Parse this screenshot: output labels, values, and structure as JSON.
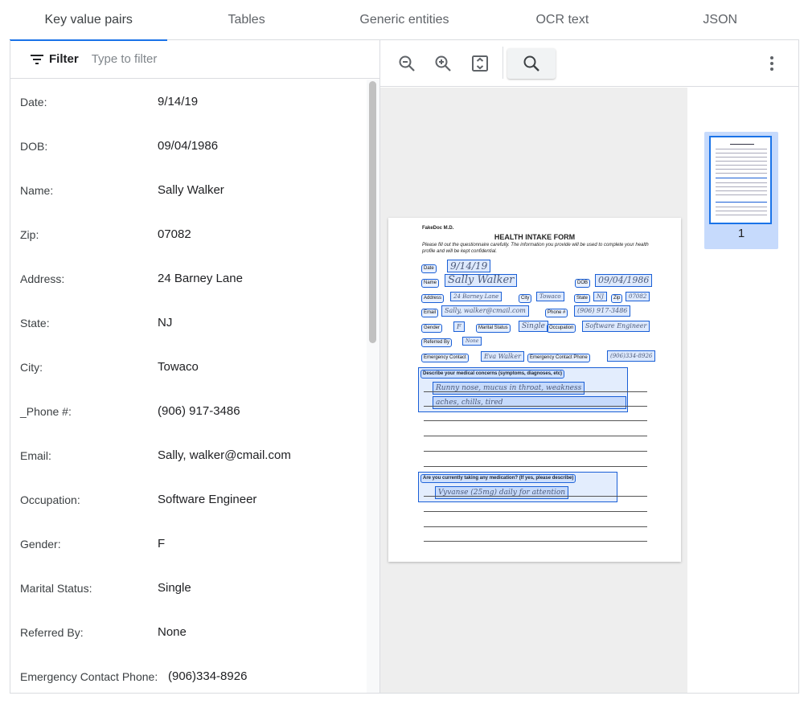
{
  "tabs": [
    "Key value pairs",
    "Tables",
    "Generic entities",
    "OCR text",
    "JSON"
  ],
  "filter": {
    "label": "Filter",
    "placeholder": "Type to filter"
  },
  "pairs": [
    {
      "key": "Date:",
      "value": "9/14/19"
    },
    {
      "key": "DOB:",
      "value": "09/04/1986"
    },
    {
      "key": "Name:",
      "value": "Sally Walker"
    },
    {
      "key": "Zip:",
      "value": "07082"
    },
    {
      "key": "Address:",
      "value": "24 Barney Lane"
    },
    {
      "key": "State:",
      "value": "NJ"
    },
    {
      "key": "City:",
      "value": "Towaco"
    },
    {
      "key": "_Phone #:",
      "value": "(906) 917-3486"
    },
    {
      "key": "Email:",
      "value": "Sally, walker@cmail.com"
    },
    {
      "key": "Occupation:",
      "value": "Software Engineer"
    },
    {
      "key": "Gender:",
      "value": "F"
    },
    {
      "key": "Marital Status:",
      "value": "Single"
    },
    {
      "key": "Referred By:",
      "value": "None"
    },
    {
      "key": "Emergency Contact Phone:",
      "value": "(906)334-8926"
    }
  ],
  "toolbar": {
    "icons": [
      "zoom-out-icon",
      "zoom-in-icon",
      "fit-page-icon",
      "search-icon",
      "more-vert-icon"
    ]
  },
  "document": {
    "org": "FakeDoc M.D.",
    "title": "HEALTH INTAKE FORM",
    "instructions": "Please fill out the questionnaire carefully. The information you provide will be used to complete your health profile and will be kept confidential.",
    "labels": {
      "date": "Date",
      "name": "Name",
      "dob": "DOB",
      "address": "Address",
      "city": "City",
      "state": "State",
      "zip": "Zip",
      "email": "Email",
      "phone": "Phone #",
      "gender": "Gender",
      "marital": "Marital Status",
      "occupation": "Occupation",
      "referred": "Referred By",
      "emergency_contact": "Emergency Contact",
      "emergency_phone": "Emergency Contact Phone",
      "concerns": "Describe your medical concerns (symptoms, diagnoses, etc)",
      "medication": "Are you currently taking any medication? (If yes, please describe)"
    },
    "handwriting": {
      "date": "9/14/19",
      "name": "Sally Walker",
      "dob": "09/04/1986",
      "address": "24 Barney Lane",
      "city": "Towaco",
      "state": "NJ",
      "zip": "07082",
      "email": "Sally, walker@cmail.com",
      "phone": "(906) 917-3486",
      "gender": "F",
      "marital": "Single",
      "occupation": "Software Engineer",
      "referred": "None",
      "emergency_contact": "Eva Walker",
      "emergency_phone": "(906)334-8926",
      "concerns_1": "Runny nose, mucus in throat, weakness",
      "concerns_2": "aches, chills, tired",
      "medication": "Vyvanse (25mg) daily for attention"
    }
  },
  "thumbnail": {
    "page_number": "1"
  },
  "colors": {
    "accent": "#1a73e8",
    "thumb_selected": "#c6dafc",
    "box": "#1a5fd6"
  }
}
